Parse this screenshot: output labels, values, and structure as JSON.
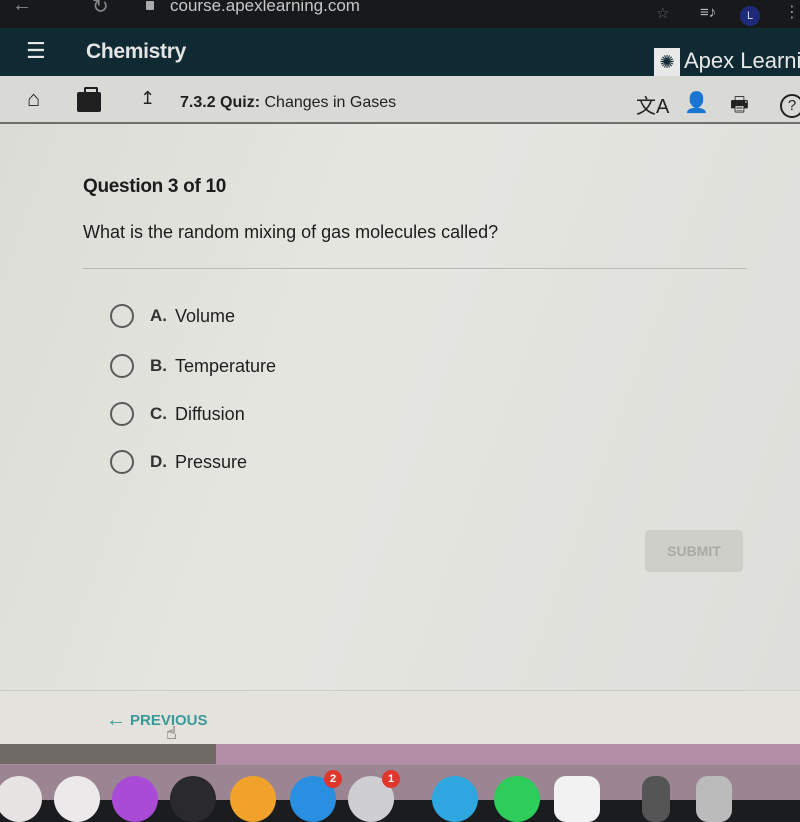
{
  "browser": {
    "url": "course.apexlearning.com",
    "profile_initial": "L"
  },
  "app_header": {
    "course_title": "Chemistry",
    "brand": "Apex Learning"
  },
  "toolbar": {
    "breadcrumb_number": "7.3.2",
    "breadcrumb_type": "Quiz:",
    "breadcrumb_title": "Changes in Gases"
  },
  "question": {
    "progress": "Question 3 of 10",
    "text": "What is the random mixing of gas molecules called?",
    "options": [
      {
        "letter": "A.",
        "label": "Volume"
      },
      {
        "letter": "B.",
        "label": "Temperature"
      },
      {
        "letter": "C.",
        "label": "Diffusion"
      },
      {
        "letter": "D.",
        "label": "Pressure"
      }
    ],
    "submit_label": "SUBMIT"
  },
  "footer": {
    "previous_label": "PREVIOUS"
  },
  "dock": {
    "badges": {
      "app_store": "2",
      "system_prefs": "1"
    }
  },
  "colors": {
    "header_bg": "#0f2a32",
    "accent": "#3b9a98"
  }
}
